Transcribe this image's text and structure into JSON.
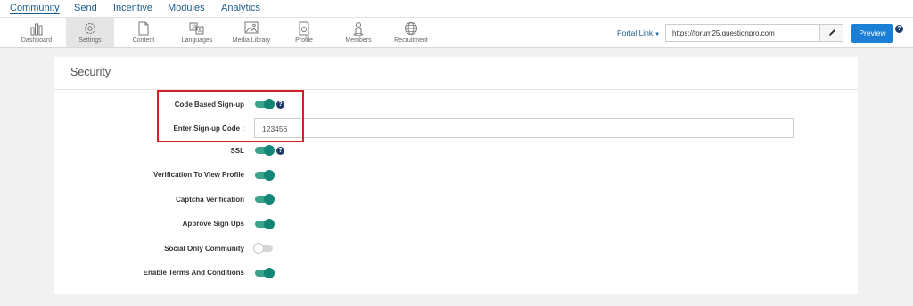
{
  "topnav": {
    "tabs": [
      {
        "label": "Community",
        "active": true
      },
      {
        "label": "Send"
      },
      {
        "label": "Incentive"
      },
      {
        "label": "Modules"
      },
      {
        "label": "Analytics"
      }
    ]
  },
  "toolbar": {
    "items": [
      {
        "label": "Dashboard",
        "icon": "bar-chart-icon"
      },
      {
        "label": "Settings",
        "icon": "gear-icon",
        "active": true
      },
      {
        "label": "Content",
        "icon": "page-icon"
      },
      {
        "label": "Languages",
        "icon": "translate-icon"
      },
      {
        "label": "Media Library",
        "icon": "image-icon"
      },
      {
        "label": "Profile",
        "icon": "profile-icon"
      },
      {
        "label": "Members",
        "icon": "person-icon"
      },
      {
        "label": "Recruitment",
        "icon": "globe-icon"
      }
    ],
    "portal_link_label": "Portal Link",
    "portal_url": "https://forum25.questionpro.com",
    "preview_label": "Preview"
  },
  "security": {
    "title": "Security",
    "code_based_signup": {
      "label": "Code Based Sign-up",
      "enabled": true
    },
    "signup_code": {
      "label": "Enter Sign-up Code :",
      "value": "123456"
    },
    "ssl": {
      "label": "SSL",
      "enabled": true
    },
    "verification_profile": {
      "label": "Verification To View Profile",
      "enabled": true
    },
    "captcha": {
      "label": "Captcha Verification",
      "enabled": true
    },
    "approve_signups": {
      "label": "Approve Sign Ups",
      "enabled": true
    },
    "social_only": {
      "label": "Social Only Community",
      "enabled": false
    },
    "terms": {
      "label": "Enable Terms And Conditions",
      "enabled": true
    }
  },
  "colors": {
    "accent": "#1b7fd6",
    "nav_text": "#1a5c8c",
    "toggle_on": "#138577",
    "highlight": "#d42028",
    "help_badge": "#1f3d6b"
  }
}
